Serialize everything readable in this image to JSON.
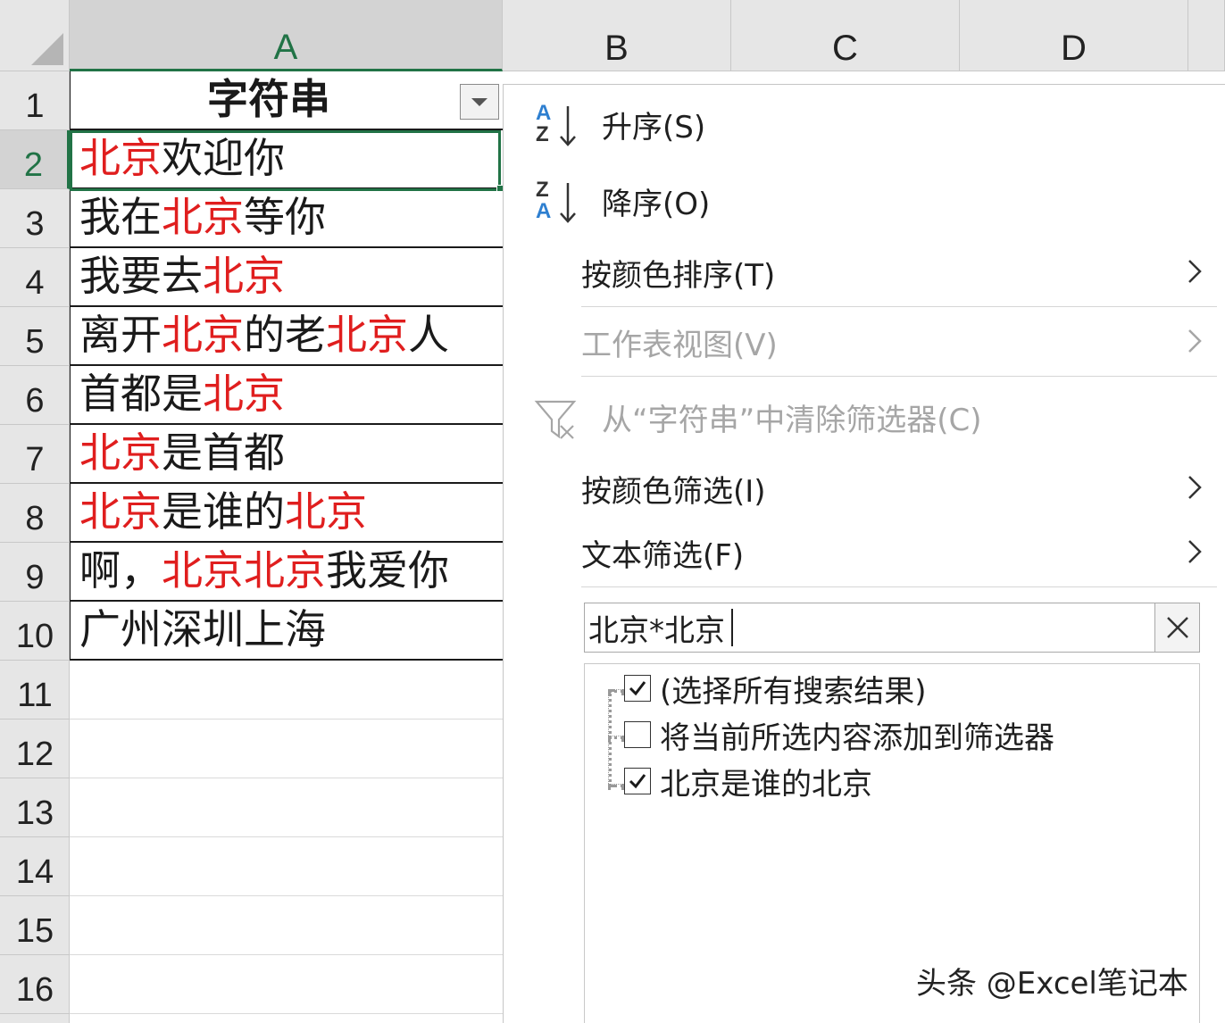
{
  "sheet": {
    "column_headers": [
      "A",
      "B",
      "C",
      "D"
    ],
    "row_headers": [
      "1",
      "2",
      "3",
      "4",
      "5",
      "6",
      "7",
      "8",
      "9",
      "10",
      "11",
      "12",
      "13",
      "14",
      "15",
      "16"
    ],
    "selected_cell": "A2",
    "header_cell": "字符串",
    "rows": [
      [
        {
          "t": "北京",
          "red": true
        },
        {
          "t": "欢迎你",
          "red": false
        }
      ],
      [
        {
          "t": "我在",
          "red": false
        },
        {
          "t": "北京",
          "red": true
        },
        {
          "t": "等你",
          "red": false
        }
      ],
      [
        {
          "t": "我要去",
          "red": false
        },
        {
          "t": "北京",
          "red": true
        }
      ],
      [
        {
          "t": "离开",
          "red": false
        },
        {
          "t": "北京",
          "red": true
        },
        {
          "t": "的老",
          "red": false
        },
        {
          "t": "北京",
          "red": true
        },
        {
          "t": "人",
          "red": false
        }
      ],
      [
        {
          "t": "首都是",
          "red": false
        },
        {
          "t": "北京",
          "red": true
        }
      ],
      [
        {
          "t": "北京",
          "red": true
        },
        {
          "t": "是首都",
          "red": false
        }
      ],
      [
        {
          "t": "北京",
          "red": true
        },
        {
          "t": "是谁的",
          "red": false
        },
        {
          "t": "北京",
          "red": true
        }
      ],
      [
        {
          "t": "啊，",
          "red": false
        },
        {
          "t": "北京北京",
          "red": true
        },
        {
          "t": "我爱你",
          "red": false
        }
      ],
      [
        {
          "t": "广州深圳上海",
          "red": false
        }
      ]
    ]
  },
  "menu": {
    "sort_asc": "升序(S)",
    "sort_desc": "降序(O)",
    "sort_by_color": "按颜色排序(T)",
    "sheet_view": "工作表视图(V)",
    "clear_filter": "从“字符串”中清除筛选器(C)",
    "filter_by_color": "按颜色筛选(I)",
    "text_filter": "文本筛选(F)",
    "az_top": "A",
    "az_bottom": "Z",
    "za_top": "Z",
    "za_bottom": "A"
  },
  "search": {
    "value": "北京*北京"
  },
  "filter_list": [
    {
      "label": "(选择所有搜索结果)",
      "checked": true
    },
    {
      "label": "将当前所选内容添加到筛选器",
      "checked": false
    },
    {
      "label": "北京是谁的北京",
      "checked": true
    }
  ],
  "watermark": "头条 @Excel笔记本",
  "colors": {
    "highlight_red": "#e01e1e",
    "excel_green": "#217346",
    "sort_icon_blue": "#2e7fd0"
  }
}
